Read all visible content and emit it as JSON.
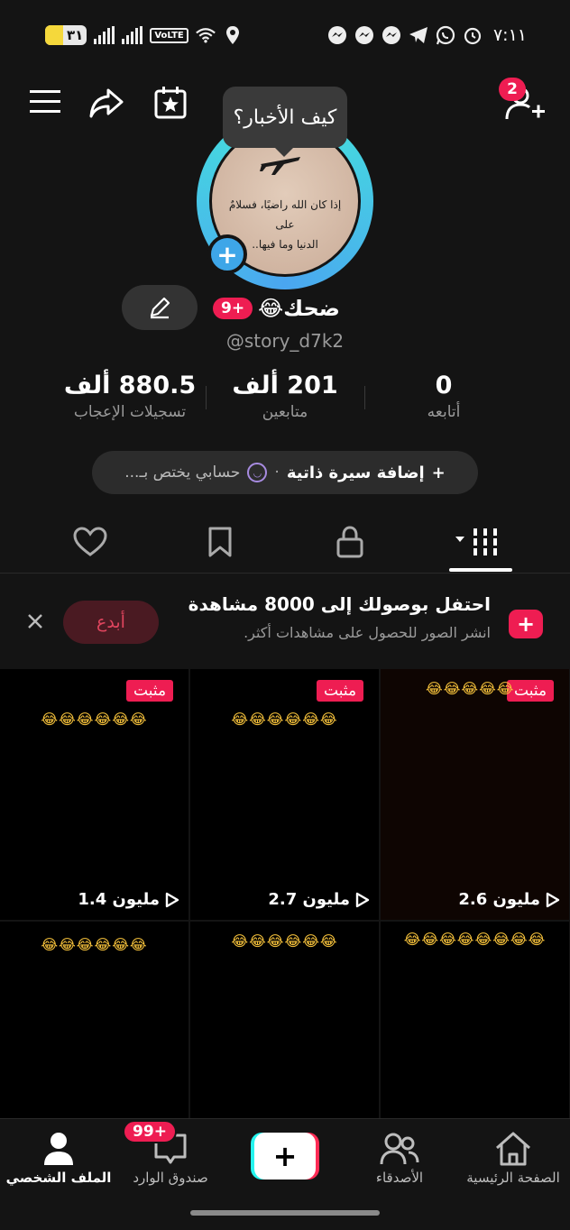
{
  "status_bar": {
    "battery": "٣١",
    "network": "VoLTE",
    "time": "٧:١١"
  },
  "header": {
    "friend_requests_badge": "2"
  },
  "avatar": {
    "tooltip": "كيف الأخبار؟",
    "quote_line1": "إذا كان الله راضيًا، فسلامٌ على",
    "quote_line2": "الدنيا وما فيها.."
  },
  "profile": {
    "name": "ضحك😂",
    "badge": "9+",
    "handle": "@story_d7k2"
  },
  "stats": {
    "following": {
      "value": "0",
      "label": "أتابعه"
    },
    "followers": {
      "value": "201 ألف",
      "label": "متابعين"
    },
    "likes": {
      "value": "880.5 ألف",
      "label": "تسجيلات الإعجاب"
    }
  },
  "bio": {
    "add_label": "إضافة سيرة ذاتية",
    "separator": "·",
    "account_label": "حسابي يختص بـ..."
  },
  "promo": {
    "title": "احتفل بوصولك إلى 8000 مشاهدة",
    "subtitle": "انشر الصور للحصول على مشاهدات أكثر.",
    "create_label": "أبدع",
    "close": "×"
  },
  "videos": [
    {
      "pinned": "مثبت",
      "emojis": "😂😂😂😂😂",
      "views": "2.6 مليون"
    },
    {
      "pinned": "مثبت",
      "emojis": "😂😂😂😂😂😂",
      "views": "2.7 مليون"
    },
    {
      "pinned": "مثبت",
      "emojis": "😂😂😂😂😂😂",
      "views": "1.4 مليون"
    },
    {
      "pinned": "",
      "emojis": "😂😂😂😂😂😂😂😂",
      "views": ""
    },
    {
      "pinned": "",
      "emojis": "😂😂😂😂😂😂",
      "views": ""
    },
    {
      "pinned": "",
      "emojis": "😂😂😂😂😂😂",
      "views": ""
    }
  ],
  "bottom_nav": {
    "home": "الصفحة الرئيسية",
    "friends": "الأصدقاء",
    "create": "+",
    "inbox": "صندوق الوارد",
    "inbox_badge": "99+",
    "profile": "الملف الشخصي"
  },
  "colors": {
    "accent": "#ee1d52",
    "background": "#141414",
    "ring_cyan": "#44e5dc",
    "ring_blue": "#4aa6f0"
  }
}
